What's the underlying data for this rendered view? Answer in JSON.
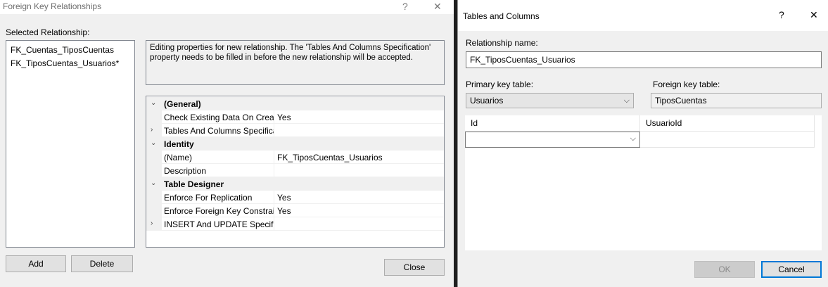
{
  "fk_dialog": {
    "title": "Foreign Key Relationships",
    "help": "?",
    "close_x": "✕",
    "selected_label": "Selected Relationship:",
    "relationships": [
      "FK_Cuentas_TiposCuentas",
      "FK_TiposCuentas_Usuarios*"
    ],
    "description": "Editing properties for new relationship.  The 'Tables And Columns Specification' property needs to be filled in before the new relationship will be accepted.",
    "properties": [
      {
        "kind": "cat",
        "expander": "⌄",
        "name": "(General)",
        "value": ""
      },
      {
        "kind": "prop",
        "expander": "",
        "name": "Check Existing Data On Creation",
        "value": "Yes"
      },
      {
        "kind": "prop",
        "expander": "›",
        "name": "Tables And Columns Specification",
        "value": ""
      },
      {
        "kind": "cat",
        "expander": "⌄",
        "name": "Identity",
        "value": ""
      },
      {
        "kind": "prop",
        "expander": "",
        "name": "(Name)",
        "value": "FK_TiposCuentas_Usuarios"
      },
      {
        "kind": "prop",
        "expander": "",
        "name": "Description",
        "value": ""
      },
      {
        "kind": "cat",
        "expander": "⌄",
        "name": "Table Designer",
        "value": ""
      },
      {
        "kind": "prop",
        "expander": "",
        "name": "Enforce For Replication",
        "value": "Yes"
      },
      {
        "kind": "prop",
        "expander": "",
        "name": "Enforce Foreign Key Constraint",
        "value": "Yes"
      },
      {
        "kind": "prop",
        "expander": "›",
        "name": "INSERT And UPDATE Specification",
        "value": ""
      }
    ],
    "add_label": "Add",
    "delete_label": "Delete",
    "close_label": "Close"
  },
  "tc_dialog": {
    "title": "Tables and Columns",
    "help": "?",
    "close_x": "✕",
    "relationship_name_label": "Relationship name:",
    "relationship_name_value": "FK_TiposCuentas_Usuarios",
    "primary_label": "Primary key table:",
    "primary_value": "Usuarios",
    "foreign_label": "Foreign key table:",
    "foreign_value": "TiposCuentas",
    "col_primary_header": "Id",
    "col_foreign_header": "UsuarioId",
    "ok_label": "OK",
    "cancel_label": "Cancel"
  },
  "icons": {
    "chevron": "⌵"
  }
}
